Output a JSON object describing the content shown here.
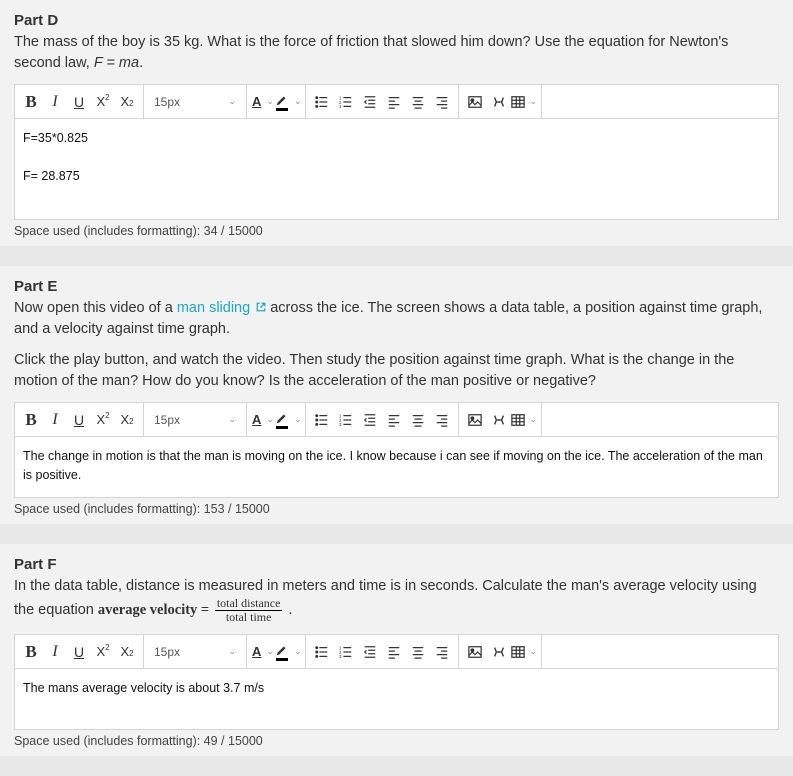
{
  "toolbar": {
    "fontSize": "15px"
  },
  "partD": {
    "title": "Part D",
    "desc_a": "The mass of the boy is 35 kg. What is the force of friction that slowed him down? Use the equation for Newton's second law, ",
    "desc_b": "F = ma",
    "desc_c": ".",
    "body_l1": "F=35*0.825",
    "body_l2": "F= 28.875",
    "stat": "Space used (includes formatting): 34 / 15000"
  },
  "partE": {
    "title": "Part E",
    "desc1_a": "Now open this video of a ",
    "desc1_link": "man sliding",
    "desc1_b": " across the ice. The screen shows a data table, a position against time graph, and a velocity against time graph.",
    "desc2": "Click the play button, and watch the video. Then study the position against time graph. What is the change in the motion of the man? How do you know? Is the acceleration of the man positive or negative?",
    "body": "The change in motion is that the man is moving on the ice. I know because i can see if moving on the ice. The acceleration of the man is positive.",
    "stat": "Space used (includes formatting): 153 / 15000"
  },
  "partF": {
    "title": "Part F",
    "desc_a": "In the data table, distance is measured in meters and time is in seconds. Calculate the man's average velocity using the equation ",
    "eq_left": "average velocity =",
    "eq_num": "total distance",
    "eq_den": "total time",
    "desc_b": " .",
    "body": "The mans average velocity is about 3.7 m/s",
    "stat": "Space used (includes formatting): 49 / 15000"
  }
}
